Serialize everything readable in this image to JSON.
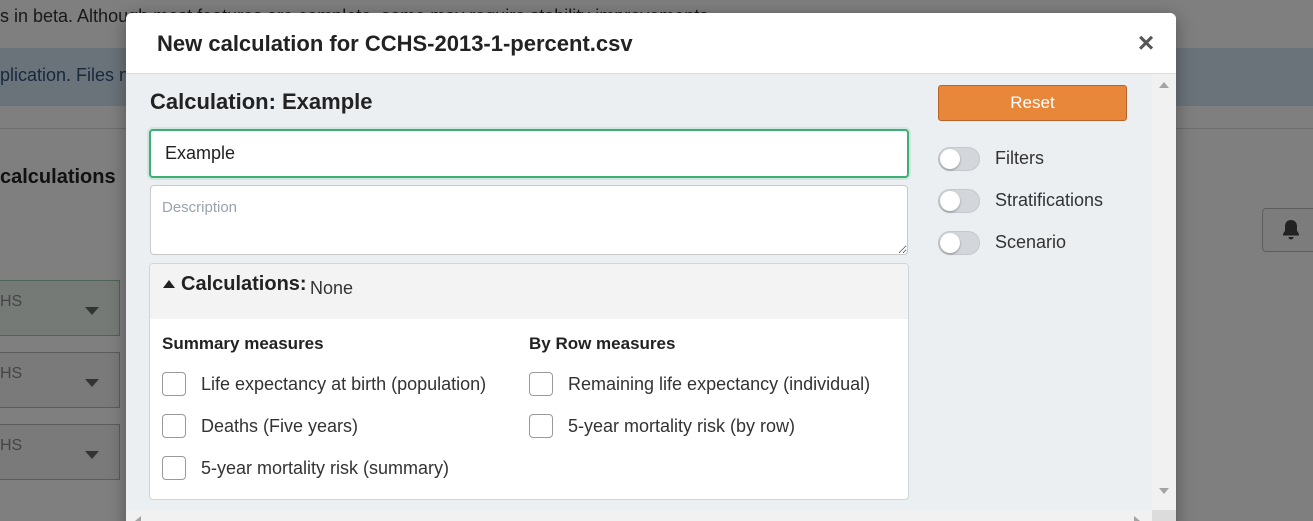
{
  "background": {
    "beta_text": "s in beta. Although most features are complete, some may require stability improvements.",
    "info_text": "plication. Files n",
    "section_heading": "calculations",
    "select_texts": [
      "HS",
      "HS",
      "HS"
    ],
    "bell_icon": "bell-icon"
  },
  "modal": {
    "title": "New calculation for CCHS-2013-1-percent.csv",
    "close_symbol": "×",
    "calculation_heading": "Calculation: Example",
    "name_value": "Example",
    "description_placeholder": "Description",
    "calculations_panel": {
      "label": "Calculations:",
      "selected": "None",
      "summary_title": "Summary measures",
      "summary_items": [
        "Life expectancy at birth (population)",
        "Deaths (Five years)",
        "5-year mortality risk (summary)"
      ],
      "row_title": "By Row measures",
      "row_items": [
        "Remaining life expectancy (individual)",
        "5-year mortality risk (by row)"
      ]
    },
    "reset_label": "Reset",
    "toggles": [
      {
        "label": "Filters",
        "on": false
      },
      {
        "label": "Stratifications",
        "on": false
      },
      {
        "label": "Scenario",
        "on": false
      }
    ]
  },
  "colors": {
    "accent_orange": "#e8873a",
    "focus_green": "#3fae74",
    "body_bg": "#ebeff2"
  }
}
